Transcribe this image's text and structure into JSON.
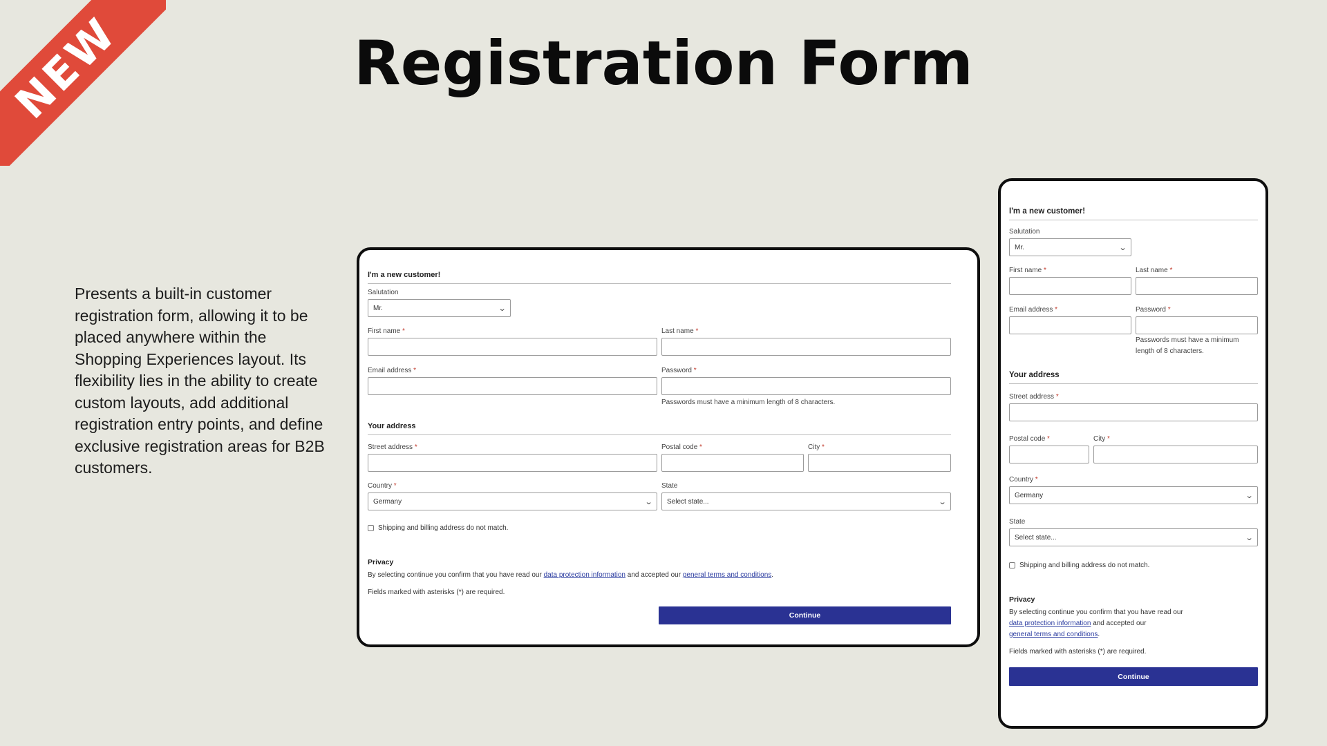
{
  "ribbon": {
    "label": "NEW"
  },
  "page_title": "Registration Form",
  "description": "Presents a built-in customer registration form, allowing it to be placed anywhere within the Shopping Experiences layout. Its flexibility lies in the ability to create custom layouts, add additional registration entry points, and define exclusive registration areas for B2B customers.",
  "form": {
    "heading": "I'm a new customer!",
    "salutation_label": "Salutation",
    "salutation_value": "Mr.",
    "first_name_label": "First name",
    "last_name_label": "Last name",
    "email_label": "Email address",
    "password_label": "Password",
    "required_mark": "*",
    "password_hint": "Passwords must have a minimum length of 8 characters.",
    "address_heading": "Your address",
    "street_label": "Street address",
    "postal_label": "Postal code",
    "city_label": "City",
    "country_label": "Country",
    "country_value": "Germany",
    "state_label": "State",
    "state_placeholder": "Select state...",
    "shipping_checkbox_label": "Shipping and billing address do not match.",
    "privacy_title": "Privacy",
    "privacy_text_1": "By selecting continue you confirm that you have read our",
    "privacy_link_1": "data protection information",
    "privacy_text_2": "and accepted our",
    "privacy_link_2": "general terms and conditions",
    "privacy_text_3": ".",
    "required_note": "Fields marked with asterisks (*) are required.",
    "continue_label": "Continue"
  },
  "icons": {
    "select_chevron": "chevron-down-icon"
  },
  "colors": {
    "ribbon": "#e04a3a",
    "button": "#2a3293",
    "link": "#2b3ca0",
    "required": "#c0392b",
    "background": "#e7e7df"
  }
}
